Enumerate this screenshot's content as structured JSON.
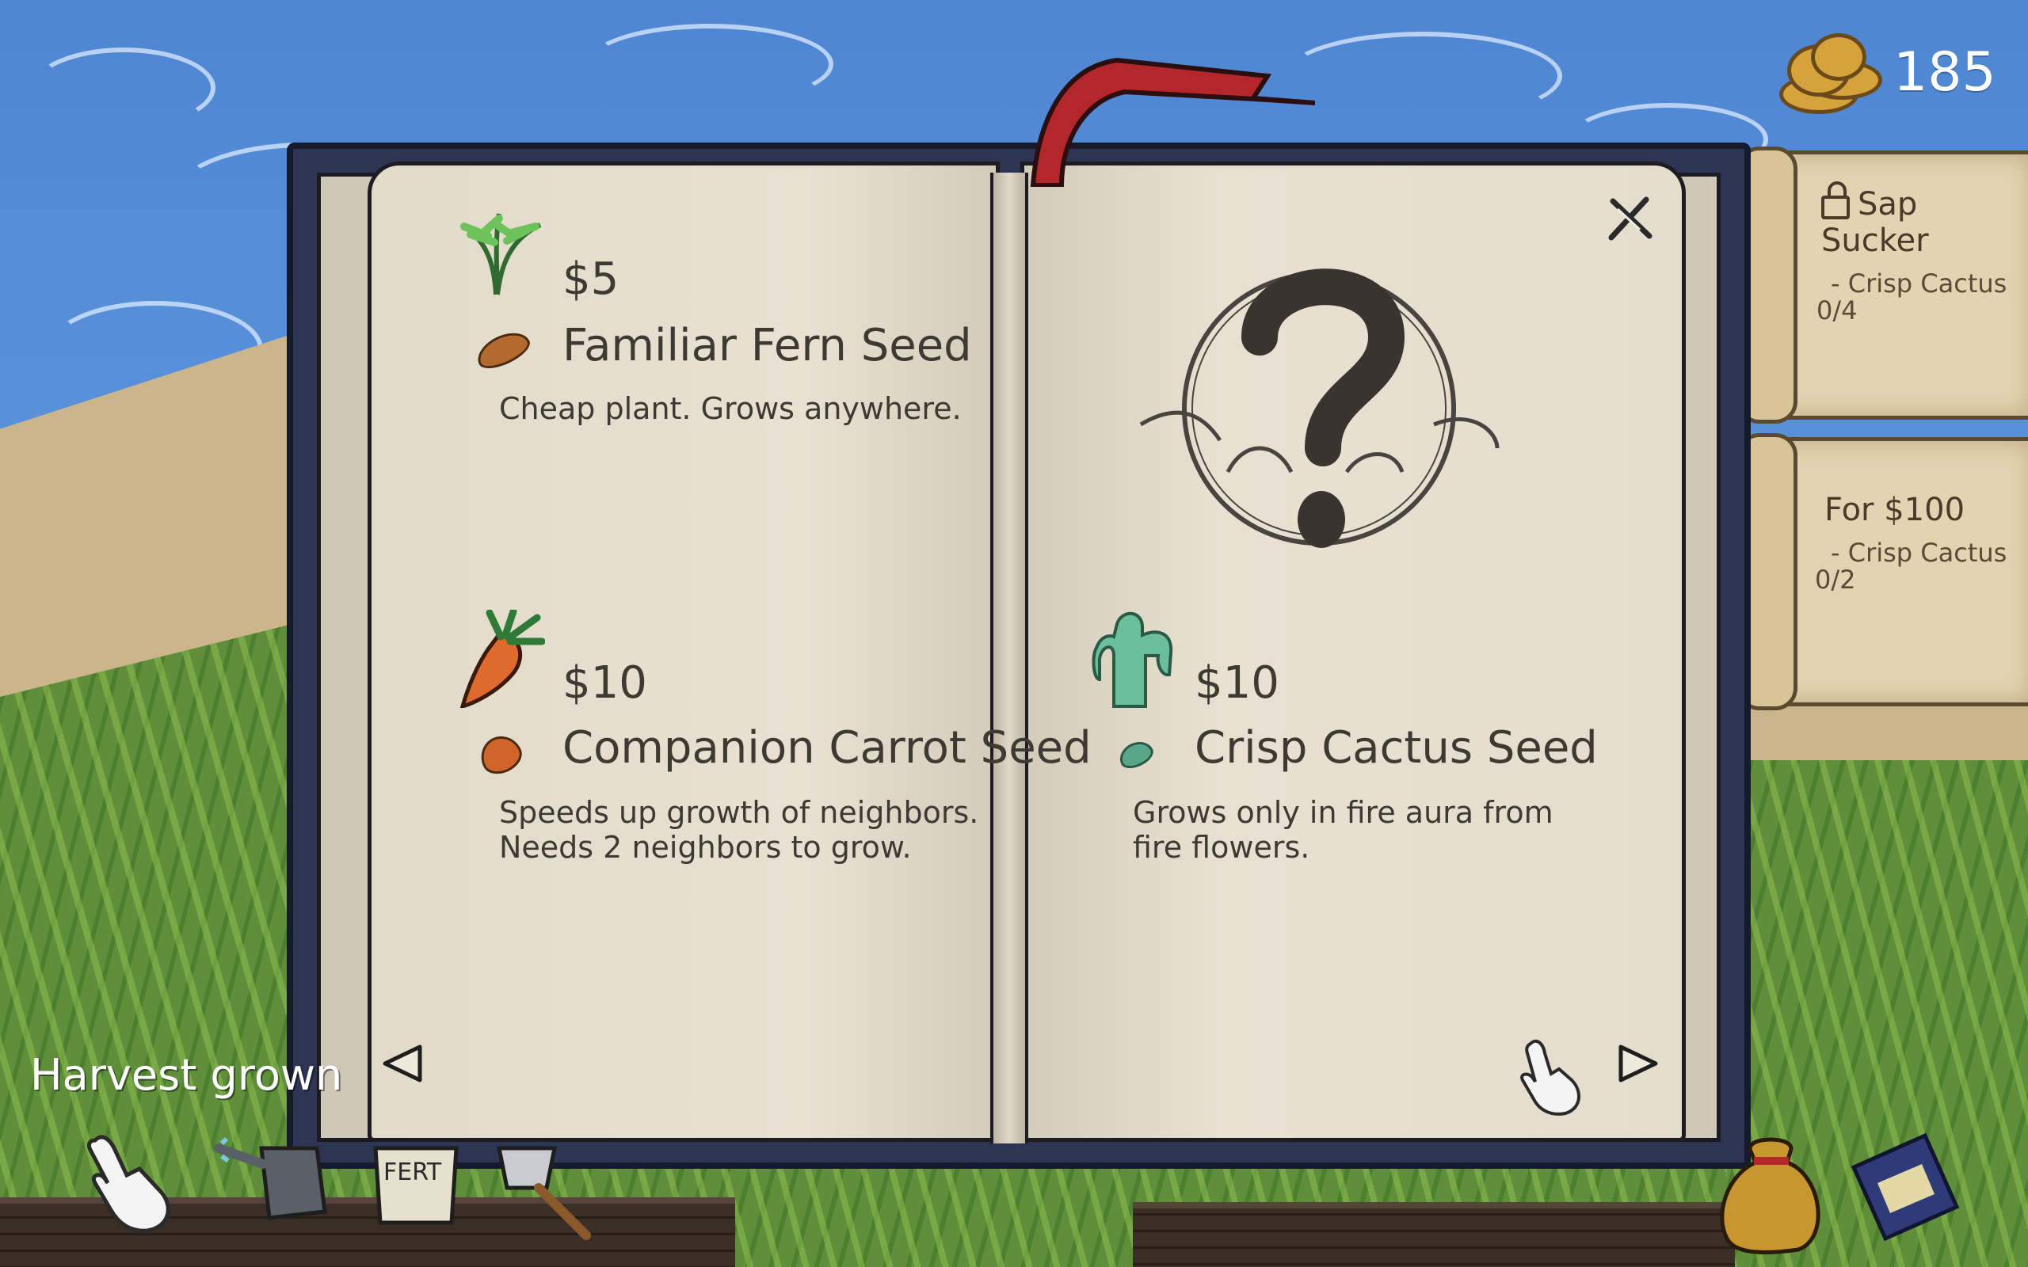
{
  "hud": {
    "coins": "185",
    "hint": "Harvest grown"
  },
  "quests": [
    {
      "title": "Sap Sucker",
      "req_item": "- Crisp Cactus",
      "req_progress": "0/4",
      "locked_icon": "unlocked-padlock-icon"
    },
    {
      "title": "For $100",
      "req_item": "- Crisp Cactus",
      "req_progress": "0/2"
    }
  ],
  "shop": {
    "items": [
      {
        "price": "$5",
        "name": "Familiar Fern Seed",
        "desc": "Cheap plant. Grows anywhere.",
        "icon": "fern-icon",
        "seed_color": "#b46a2c"
      },
      {
        "price": "$10",
        "name": "Companion Carrot Seed",
        "desc": "Speeds up growth of neighbors.\nNeeds 2 neighbors to grow.",
        "icon": "carrot-icon",
        "seed_color": "#d0642a"
      },
      {
        "price": "$10",
        "name": "Crisp Cactus Seed",
        "desc": "Grows only in fire aura from fire flowers.",
        "icon": "cactus-icon",
        "seed_color": "#5aa68a"
      }
    ],
    "locked_slot_icon": "mystery-question-mark-icon"
  },
  "colors": {
    "book_cover": "#2e3554",
    "page": "#e6dfcf",
    "ribbon": "#b2262c",
    "ink": "#3e3a33"
  }
}
